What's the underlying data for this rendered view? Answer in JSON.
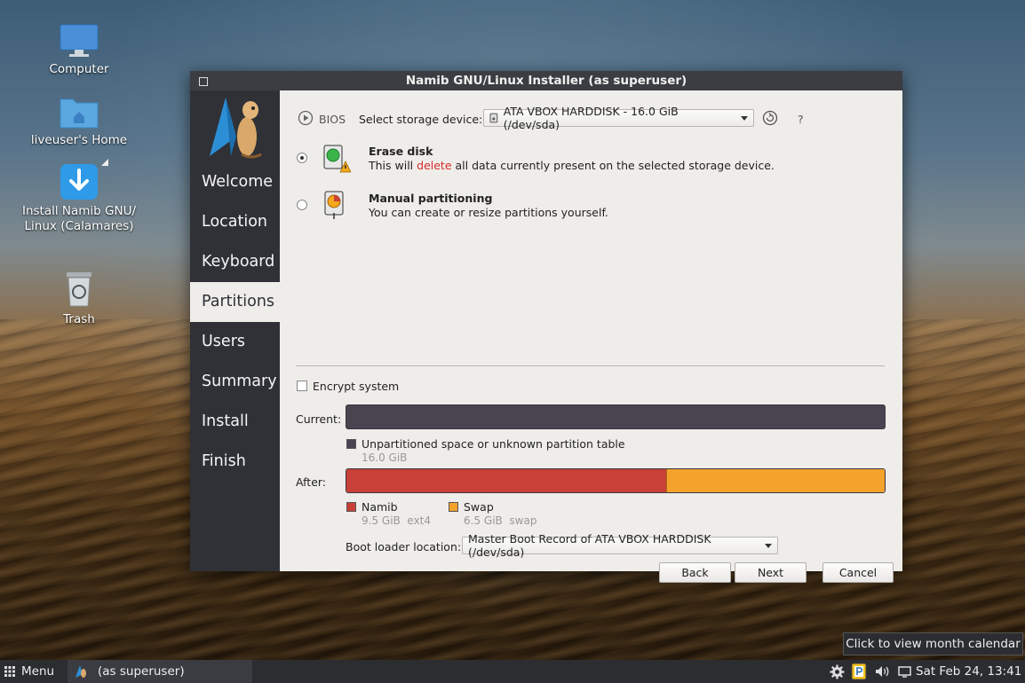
{
  "desktop": {
    "icons": [
      {
        "label": "Computer"
      },
      {
        "label": "liveuser's Home"
      },
      {
        "label_line1": "Install Namib GNU/",
        "label_line2": "Linux (Calamares)"
      },
      {
        "label": "Trash"
      }
    ]
  },
  "window": {
    "title": "Namib GNU/Linux Installer (as superuser)"
  },
  "sidebar": {
    "steps": [
      {
        "label": "Welcome"
      },
      {
        "label": "Location"
      },
      {
        "label": "Keyboard"
      },
      {
        "label": "Partitions"
      },
      {
        "label": "Users"
      },
      {
        "label": "Summary"
      },
      {
        "label": "Install"
      },
      {
        "label": "Finish"
      }
    ],
    "active_step": "Partitions"
  },
  "partitions": {
    "firmware_label": "BIOS",
    "storage_label": "Select storage device:",
    "storage_value": "ATA VBOX HARDDISK - 16.0 GiB (/dev/sda)",
    "help_glyph": "?",
    "options": [
      {
        "title": "Erase disk",
        "desc_before": "This will ",
        "desc_danger": "delete",
        "desc_after": " all data currently present on the selected storage device.",
        "selected": true
      },
      {
        "title": "Manual partitioning",
        "desc": "You can create or resize partitions yourself.",
        "selected": false
      }
    ],
    "encrypt_label": "Encrypt system",
    "encrypt_checked": false,
    "current_label": "Current:",
    "after_label": "After:",
    "current_partitions": [
      {
        "name": "Unpartitioned space or unknown partition table",
        "size": "16.0 GiB",
        "color": "#4a4450"
      }
    ],
    "after_partitions": [
      {
        "name": "Namib",
        "size": "9.5 GiB",
        "fs": "ext4",
        "color": "#c94038",
        "fraction": 0.594
      },
      {
        "name": "Swap",
        "size": "6.5 GiB",
        "fs": "swap",
        "color": "#f4a22b",
        "fraction": 0.406
      }
    ],
    "bootloader_label": "Boot loader location:",
    "bootloader_value": "Master Boot Record of ATA VBOX HARDDISK (/dev/sda)"
  },
  "buttons": {
    "back": "Back",
    "next": "Next",
    "cancel": "Cancel"
  },
  "taskbar": {
    "menu_label": "Menu",
    "task_label": "(as superuser)",
    "clock": "Sat Feb 24, 13:41",
    "tooltip": "Click to view month calendar"
  },
  "colors": {
    "sidebar_bg": "#2f3137",
    "titlebar_bg": "#3b3d42",
    "accent_red": "#c94038",
    "accent_orange": "#f4a22b"
  }
}
